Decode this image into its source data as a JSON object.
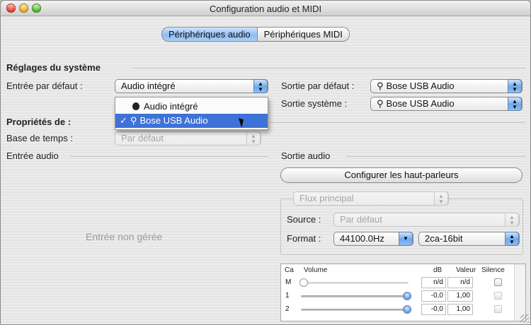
{
  "window": {
    "title": "Configuration audio et MIDI"
  },
  "tabs": [
    {
      "label": "Périphériques audio",
      "selected": true
    },
    {
      "label": "Périphériques MIDI",
      "selected": false
    }
  ],
  "system_settings": {
    "heading": "Réglages du système",
    "default_input_label": "Entrée par défaut :",
    "default_input_value": "Audio intégré",
    "default_output_label": "Sortie par défaut :",
    "default_output_value": "Bose USB Audio",
    "system_output_label": "Sortie système :",
    "system_output_value": "Bose USB Audio"
  },
  "input_menu": {
    "items": [
      {
        "label": "Audio intégré",
        "icon": "apple-icon",
        "checked": false,
        "highlighted": false
      },
      {
        "label": "Bose USB Audio",
        "icon": "usb-icon",
        "checked": true,
        "highlighted": true
      }
    ],
    "checkmark": "✓"
  },
  "properties": {
    "heading": "Propriétés de :",
    "clock_label": "Base de temps :",
    "clock_value": "Par défaut"
  },
  "audio_input": {
    "heading": "Entrée audio",
    "placeholder": "Entrée non gérée"
  },
  "audio_output": {
    "heading": "Sortie audio",
    "configure_button": "Configurer les haut-parleurs",
    "stream_value": "Flux principal",
    "source_label": "Source :",
    "source_value": "Par défaut",
    "format_label": "Format :",
    "format_rate": "44100.0Hz",
    "format_bits": "2ca-16bit"
  },
  "mixer": {
    "headers": {
      "channel": "Ca",
      "volume": "Volume",
      "db": "dB",
      "value": "Valeur",
      "mute": "Silence"
    },
    "rows": [
      {
        "channel": "M",
        "db": "n/d",
        "value": "n/d",
        "level": 0.0
      },
      {
        "channel": "1",
        "db": "-0,0",
        "value": "1,00",
        "level": 1.0
      },
      {
        "channel": "2",
        "db": "-0,0",
        "value": "1,00",
        "level": 1.0
      }
    ]
  },
  "colors": {
    "accent": "#3e72d6",
    "tab_selected": "#8fbdf2"
  }
}
